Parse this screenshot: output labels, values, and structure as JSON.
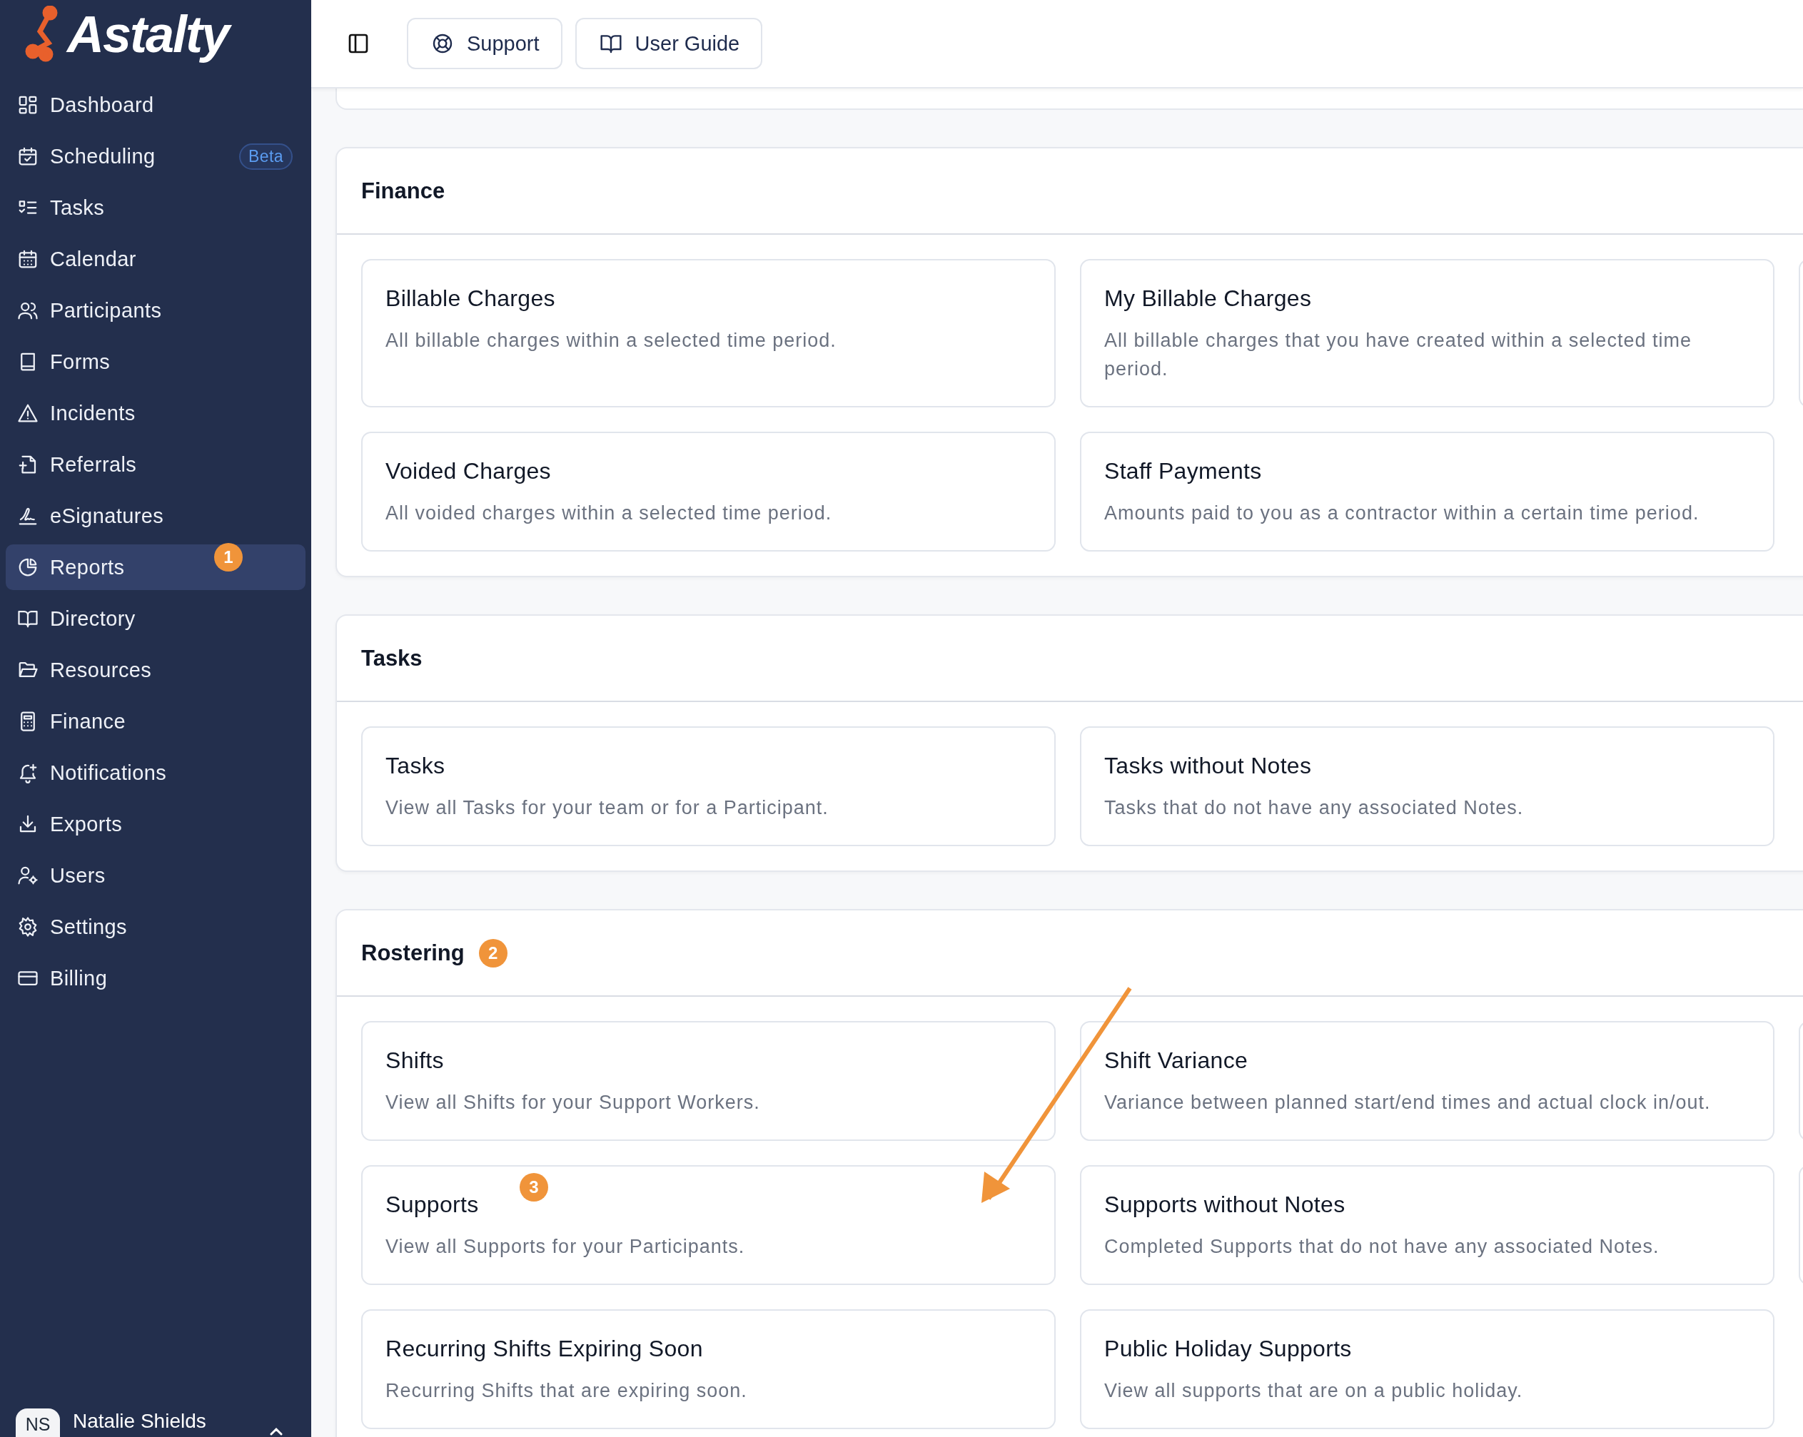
{
  "logo": {
    "text": "Astalty"
  },
  "sidebar": {
    "items": [
      {
        "label": "Dashboard",
        "selected": false
      },
      {
        "label": "Scheduling",
        "selected": false,
        "badge": "Beta"
      },
      {
        "label": "Tasks",
        "selected": false
      },
      {
        "label": "Calendar",
        "selected": false
      },
      {
        "label": "Participants",
        "selected": false
      },
      {
        "label": "Forms",
        "selected": false
      },
      {
        "label": "Incidents",
        "selected": false
      },
      {
        "label": "Referrals",
        "selected": false
      },
      {
        "label": "eSignatures",
        "selected": false
      },
      {
        "label": "Reports",
        "selected": true,
        "marker": "1"
      },
      {
        "label": "Directory",
        "selected": false
      },
      {
        "label": "Resources",
        "selected": false
      },
      {
        "label": "Finance",
        "selected": false
      },
      {
        "label": "Notifications",
        "selected": false
      },
      {
        "label": "Exports",
        "selected": false
      },
      {
        "label": "Users",
        "selected": false
      },
      {
        "label": "Settings",
        "selected": false
      },
      {
        "label": "Billing",
        "selected": false
      }
    ]
  },
  "user": {
    "initials": "NS",
    "name": "Natalie Shields"
  },
  "toolbar": {
    "buttons": [
      "Support",
      "User Guide"
    ]
  },
  "sections": [
    {
      "title": "Finance",
      "tiles": [
        {
          "kind": "report",
          "title": "Billable Charges",
          "description": "All billable charges within a selected time period."
        },
        {
          "kind": "report",
          "title": "My Billable Charges",
          "description": "All billable charges that you have created within a selected time period."
        },
        {
          "kind": "clipped"
        },
        {
          "kind": "report",
          "title": "Voided Charges",
          "description": "All voided charges within a selected time period."
        },
        {
          "kind": "report",
          "title": "Staff Payments",
          "description": "Amounts paid to you as a contractor within a certain time period."
        }
      ]
    },
    {
      "title": "Tasks",
      "tiles": [
        {
          "kind": "report",
          "title": "Tasks",
          "description": "View all Tasks for your team or for a Participant."
        },
        {
          "kind": "report",
          "title": "Tasks without Notes",
          "description": "Tasks that do not have any associated Notes."
        }
      ]
    },
    {
      "title": "Rostering",
      "marker": "2",
      "tiles": [
        {
          "kind": "report",
          "title": "Shifts",
          "description": "View all Shifts for your Support Workers."
        },
        {
          "kind": "report",
          "title": "Shift Variance",
          "description": "Variance between planned start/end times and actual clock in/out."
        },
        {
          "kind": "clipped"
        },
        {
          "kind": "report",
          "title": "Supports",
          "description": "View all Supports for your Participants.",
          "marker": "3"
        },
        {
          "kind": "report",
          "title": "Supports without Notes",
          "description": "Completed Supports that do not have any associated Notes."
        },
        {
          "kind": "clipped"
        },
        {
          "kind": "report",
          "title": "Recurring Shifts Expiring Soon",
          "description": "Recurring Shifts that are expiring soon."
        },
        {
          "kind": "report",
          "title": "Public Holiday Supports",
          "description": "View all supports that are on a public holiday."
        }
      ]
    }
  ]
}
